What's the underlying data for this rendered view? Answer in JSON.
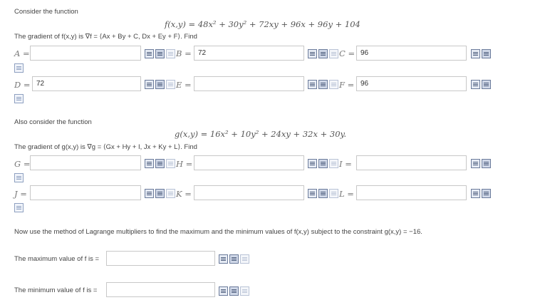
{
  "intro1": "Consider the function",
  "f_func": "f(x,y) = 48x² + 30y² + 72xy + 96x + 96y + 104",
  "grad_f": "The gradient of f(x,y) is ∇f = ⟨Ax + By + C, Dx + Ey + F⟩. Find",
  "fields1": {
    "A": {
      "label": "A =",
      "value": ""
    },
    "B": {
      "label": "B =",
      "value": "72"
    },
    "C": {
      "label": "C =",
      "value": "96"
    },
    "D": {
      "label": "D =",
      "value": "72"
    },
    "E": {
      "label": "E =",
      "value": ""
    },
    "F": {
      "label": "F =",
      "value": "96"
    }
  },
  "intro2": "Also consider the function",
  "g_func": "g(x,y) = 16x² + 10y² + 24xy + 32x + 30y.",
  "grad_g": "The gradient of g(x,y) is ∇g = ⟨Gx + Hy + I, Jx + Ky + L⟩. Find",
  "fields2": {
    "G": {
      "label": "G =",
      "value": ""
    },
    "H": {
      "label": "H =",
      "value": ""
    },
    "I": {
      "label": "I =",
      "value": ""
    },
    "J": {
      "label": "J =",
      "value": ""
    },
    "K": {
      "label": "K =",
      "value": ""
    },
    "L": {
      "label": "L =",
      "value": ""
    }
  },
  "lagrange": "Now use the method of Lagrange multipliers to find the maximum and the minimum values of f(x,y) subject to the constraint g(x,y) = −16.",
  "max_label": "The maximum value of f is =",
  "max_value": "",
  "min_label": "The minimum value of f  is =",
  "min_value": ""
}
